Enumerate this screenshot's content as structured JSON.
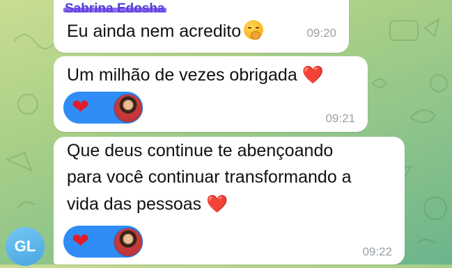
{
  "theme": {
    "bubble_color": "#ffffff",
    "reaction_color": "#2f8df5",
    "avatar_color": "#4aa7e3",
    "time_color": "#9aa0a6"
  },
  "messages": [
    {
      "sender": "Sabrina Edosha",
      "text": "Eu ainda nem acredito",
      "emoji_icon": "face-with-hand-over-mouth-icon",
      "time": "09:20"
    },
    {
      "text": "Um milhão de vezes obrigada",
      "emoji": "❤️",
      "reaction": {
        "emoji": "❤",
        "avatar": "reactor-avatar"
      },
      "time": "09:21"
    },
    {
      "lines": [
        "Que deus continue te abençoando",
        "para você continuar transformando a",
        "vida das pessoas"
      ],
      "emoji": "❤️",
      "reaction": {
        "emoji": "❤",
        "avatar": "reactor-avatar"
      },
      "time": "09:22"
    }
  ],
  "sender_avatar": {
    "initials": "GL"
  }
}
